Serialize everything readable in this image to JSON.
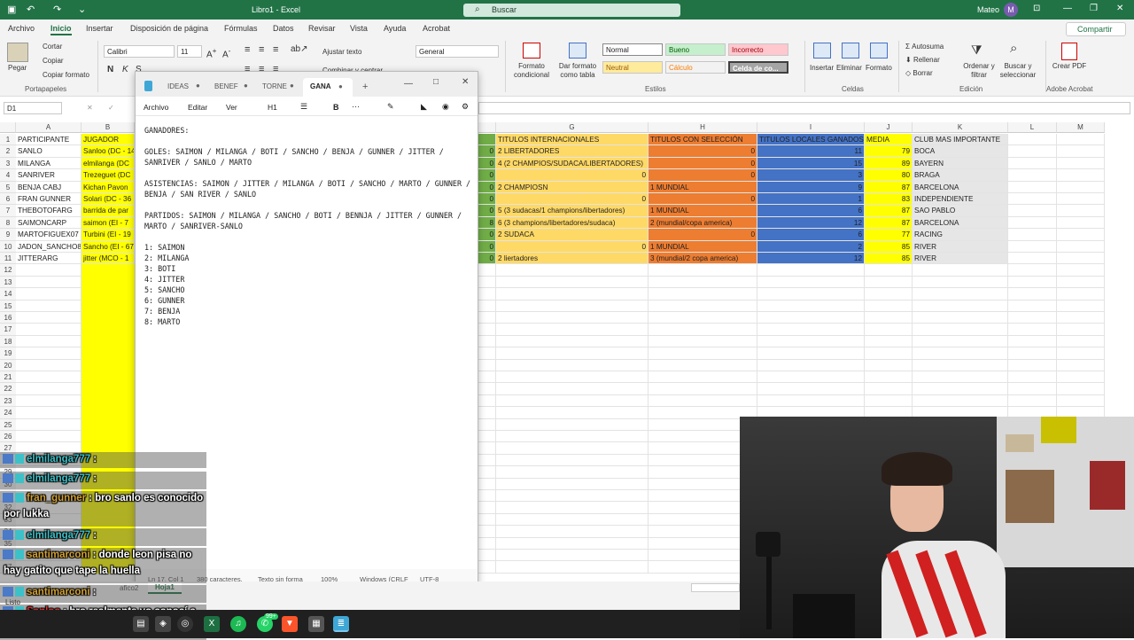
{
  "app": {
    "title": "Libro1 - Excel",
    "search_placeholder": "Buscar",
    "user_name": "Mateo",
    "user_initial": "M",
    "share_label": "Compartir"
  },
  "menu": [
    "Archivo",
    "Inicio",
    "Insertar",
    "Disposición de página",
    "Fórmulas",
    "Datos",
    "Revisar",
    "Vista",
    "Ayuda",
    "Acrobat"
  ],
  "ribbon": {
    "paste": "Pegar",
    "cut": "Cortar",
    "copy": "Copiar",
    "format_painter": "Copiar formato",
    "clipboard_group": "Portapapeles",
    "font_name": "Calibri",
    "font_size": "11",
    "bold": "N",
    "italic": "K",
    "underline": "S",
    "wrap_text": "Ajustar texto",
    "merge": "Combinar y centrar",
    "number_format": "General",
    "cond_format": "Formato condicional",
    "table_format": "Dar formato como tabla",
    "styles": {
      "normal": "Normal",
      "good": "Bueno",
      "bad": "Incorrecto",
      "neutral": "Neutral",
      "calc": "Cálculo",
      "check": "Celda de co..."
    },
    "styles_group": "Estilos",
    "insert": "Insertar",
    "delete": "Eliminar",
    "format": "Formato",
    "cells_group": "Celdas",
    "autosum": "Autosuma",
    "fill": "Rellenar",
    "clear": "Borrar",
    "sort": "Ordenar y filtrar",
    "find": "Buscar y seleccionar",
    "edit_group": "Edición",
    "pdf": "Crear PDF",
    "adobe_group": "Adobe Acrobat"
  },
  "formula_bar": {
    "name_box": "D1",
    "cancel": "✕",
    "confirm": "✓",
    "fx": "fx"
  },
  "columns": [
    "A",
    "B",
    "F",
    "G",
    "H",
    "I",
    "J",
    "K",
    "L",
    "M"
  ],
  "rows": [
    "1",
    "2",
    "3",
    "4",
    "5",
    "6",
    "7",
    "8",
    "9",
    "10",
    "11",
    "12",
    "13",
    "14",
    "15",
    "16",
    "17",
    "18",
    "19",
    "20",
    "21",
    "22",
    "23",
    "24",
    "25",
    "26",
    "27",
    "28",
    "29",
    "30",
    "31",
    "32",
    "33",
    "34",
    "35",
    "36",
    "37"
  ],
  "sheet": {
    "col_a": [
      "PARTICIPANTE",
      "SANLO",
      "MILANGA",
      "SANRIVER",
      "BENJA CABJ",
      "FRAN GUNNER",
      "THEBOTOFARG",
      "SAIMONCARP",
      "MARTOFIGUEX07",
      "JADON_SANCHO8",
      "JITTERARG"
    ],
    "col_b": [
      "JUGADOR",
      "Sanloo (DC - 14",
      "elmilanga (DC",
      "Trezeguet (DC",
      "Kichan Pavon",
      "Solari (DC - 36",
      "barrida de par",
      "saimon (EI - 7",
      "Turbini (EI - 19",
      "Sancho (EI - 67",
      "jitter (MCO - 1"
    ],
    "col_f": [
      "",
      "0",
      "0",
      "0",
      "0",
      "0",
      "0",
      "8",
      "0",
      "0",
      "0"
    ],
    "col_g": [
      "TITULOS INTERNACIONALES",
      "2 LIBERTADORES",
      "4 (2 CHAMPIOS/SUDACA/LIBERTADORES)",
      "0",
      "2 CHAMPIOSN",
      "0",
      "5 (3 sudacas/1 champions/libertadores)",
      "6 (3 champions/libertadores/sudaca)",
      "2 SUDACA",
      "0",
      "2 liertadores"
    ],
    "col_h": [
      "TITULOS CON SELECCIÓN",
      "0",
      "0",
      "0",
      "1 MUNDIAL",
      "0",
      "1 MUNDIAL",
      "2 (mundial/copa america)",
      "0",
      "1 MUNDIAL",
      "3 (mundial/2 copa america)"
    ],
    "col_i": [
      "TITULOS LOCALES GANADOS",
      "11",
      "15",
      "3",
      "9",
      "1",
      "6",
      "12",
      "6",
      "2",
      "12"
    ],
    "col_j": [
      "MEDIA",
      "79",
      "89",
      "80",
      "87",
      "83",
      "87",
      "87",
      "77",
      "85",
      "85"
    ],
    "col_k": [
      "CLUB MAS IMPORTANTE",
      "BOCA",
      "BAYERN",
      "BRAGA",
      "BARCELONA",
      "INDEPENDIENTE",
      "SAO PABLO",
      "BARCELONA",
      "RACING",
      "RIVER",
      "RIVER"
    ]
  },
  "colors": {
    "excel_green": "#217346",
    "yellow": "#ffff00",
    "orange": "#f4b183",
    "dark_orange": "#ed7d31",
    "blue": "#4472c4",
    "gray": "#e7e6e6",
    "green": "#70ad47",
    "light_yellow": "#ffd966"
  },
  "notepad": {
    "tabs": [
      "IDEAS",
      "BENEF",
      "TORNE",
      "GANA"
    ],
    "menu": [
      "Archivo",
      "Editar",
      "Ver"
    ],
    "heading": "H1",
    "bold": "B",
    "more": "···",
    "text": "GANADORES:\n\nGOLES: SAIMON / MILANGA / BOTI / SANCHO / BENJA / GUNNER / JITTER / SANRIVER / SANLO / MARTO\n\nASISTENCIAS: SAIMON / JITTER / MILANGA / BOTI / SANCHO / MARTO / GUNNER / BENJA / SAN RIVER / SANLO\n\nPARTIDOS: SAIMON / MILANGA / SANCHO / BOTI / BENNJA / JITTER / GUNNER / MARTO / SANRIVER-SANLO\n\n1: SAIMON\n2: MILANGA\n3: BOTI\n4: JITTER\n5: SANCHO\n6: GUNNER\n7: BENJA\n8: MARTO",
    "status": {
      "pos": "Ln 17, Col 1",
      "chars": "380 caracteres.",
      "format": "Texto sin forma",
      "zoom": "100%",
      "eol": "Windows (CRLF",
      "enc": "UTF-8"
    }
  },
  "sheet_tabs": {
    "other": "afico2",
    "active": "Hoja1"
  },
  "status_bar": {
    "ready": "Listo"
  },
  "chat": [
    {
      "user": "elmilanga777",
      "msg": ":",
      "color": "#3cc1c8"
    },
    {
      "user": "elmilanga777",
      "msg": ":",
      "color": "#3cc1c8"
    },
    {
      "user": "fran_gunner",
      "msg": ": bro sanlo es conocido",
      "cont": "por lukka",
      "color": "#d2a032"
    },
    {
      "user": "elmilanga777",
      "msg": ":",
      "color": "#3cc1c8"
    },
    {
      "user": "santimarconi",
      "msg": ": donde leon pisa no",
      "cont": "hay gatito que tape la huella",
      "color": "#d2a032"
    },
    {
      "user": "santimarconi",
      "msg": ":",
      "color": "#d2a032"
    },
    {
      "user": "Sanloo",
      "msg": ": bro realmente yo conocí a",
      "cont": "matini y lukka lo conocio por mi",
      "color": "#e03030"
    }
  ],
  "taskbar": {
    "badge": "99+"
  }
}
